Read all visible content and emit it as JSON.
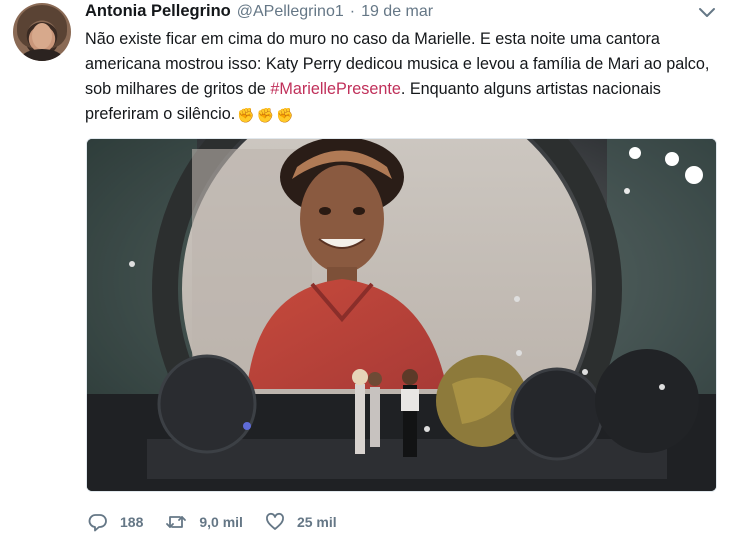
{
  "tweet": {
    "author_name": "Antonia Pellegrino",
    "handle": "@APellegrino1",
    "separator": "·",
    "date": "19 de mar",
    "text_before": "Não existe ficar em cima do muro no caso da Marielle. E esta noite uma cantora americana mostrou isso: Katy Perry dedicou musica e levou a família de Mari ao palco, sob milhares de gritos de ",
    "hashtag": "#MariellePresente",
    "text_after": ". Enquanto alguns artistas nacionais preferiram o silêncio.",
    "emojis": [
      "✊",
      "✊",
      "✊"
    ],
    "media": {
      "description_icon": "photo"
    },
    "actions": {
      "reply_count": "188",
      "retweet_count": "9,0 mil",
      "like_count": "25 mil"
    }
  },
  "colors": {
    "text": "#14171a",
    "muted": "#657786",
    "hashtag": "#c0305a",
    "border": "#e1e8ed"
  }
}
